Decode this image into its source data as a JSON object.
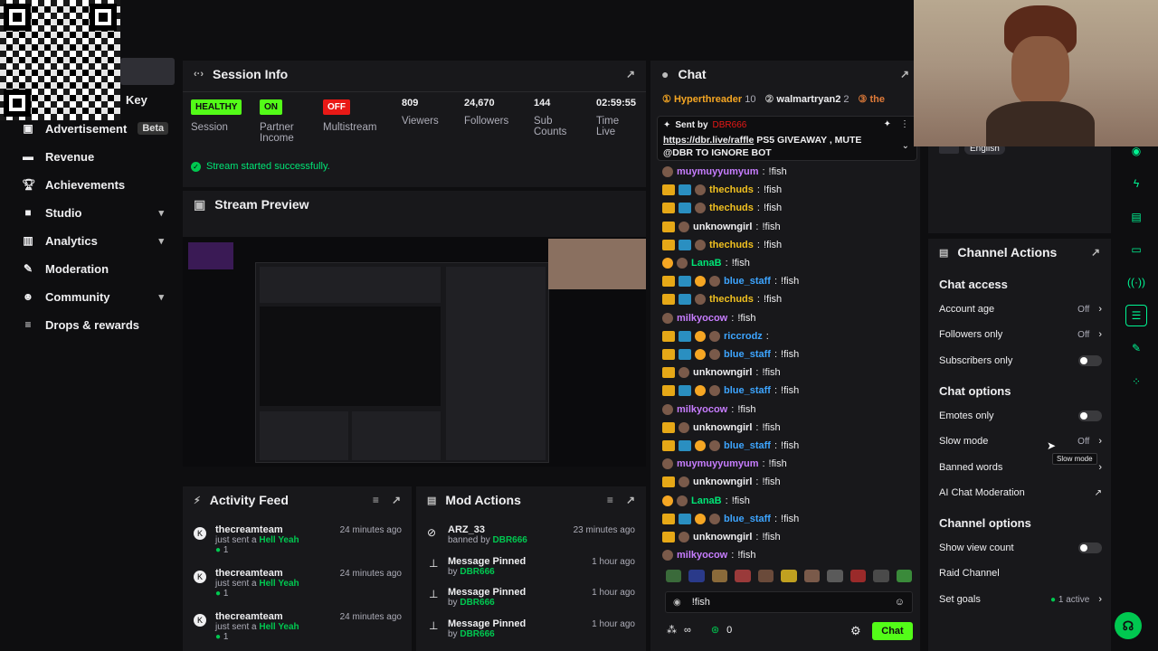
{
  "nav": {
    "key_label": "Key",
    "items": [
      {
        "label": "Advertisement",
        "badge": "Beta",
        "icon": "megaphone-icon"
      },
      {
        "label": "Revenue",
        "icon": "money-icon"
      },
      {
        "label": "Achievements",
        "icon": "trophy-icon"
      },
      {
        "label": "Studio",
        "icon": "camera-icon"
      },
      {
        "label": "Analytics",
        "icon": "chart-icon"
      },
      {
        "label": "Moderation",
        "icon": "wrench-icon"
      },
      {
        "label": "Community",
        "icon": "people-icon"
      },
      {
        "label": "Drops & rewards",
        "icon": "gift-icon"
      }
    ]
  },
  "session": {
    "title": "Session Info",
    "health_tag": "HEALTHY",
    "health_label": "Session",
    "partner_tag": "ON",
    "partner_label1": "Partner",
    "partner_label2": "Income",
    "multistream_tag": "OFF",
    "multistream_label": "Multistream",
    "viewers_value": "809",
    "viewers_label": "Viewers",
    "followers_value": "24,670",
    "followers_label": "Followers",
    "subs_value": "144",
    "subs_label1": "Sub",
    "subs_label2": "Counts",
    "time_value": "02:59:55",
    "time_label1": "Time",
    "time_label2": "Live",
    "status_msg": "Stream started successfully."
  },
  "preview": {
    "title": "Stream Preview"
  },
  "activity": {
    "title": "Activity Feed",
    "items": [
      {
        "name": "thecreamteam",
        "action": "just sent a",
        "item": "Hell Yeah",
        "count": "1",
        "time": "24 minutes ago"
      },
      {
        "name": "thecreamteam",
        "action": "just sent a",
        "item": "Hell Yeah",
        "count": "1",
        "time": "24 minutes ago"
      },
      {
        "name": "thecreamteam",
        "action": "just sent a",
        "item": "Hell Yeah",
        "count": "1",
        "time": "24 minutes ago"
      }
    ]
  },
  "mod": {
    "title": "Mod Actions",
    "items": [
      {
        "title": "ARZ_33",
        "by_prefix": "banned by",
        "by": "DBR666",
        "time": "23 minutes ago"
      },
      {
        "title": "Message Pinned",
        "by_prefix": "by",
        "by": "DBR666",
        "time": "1 hour ago"
      },
      {
        "title": "Message Pinned",
        "by_prefix": "by",
        "by": "DBR666",
        "time": "1 hour ago"
      },
      {
        "title": "Message Pinned",
        "by_prefix": "by",
        "by": "DBR666",
        "time": "1 hour ago"
      }
    ]
  },
  "chat": {
    "title": "Chat",
    "top_gifters": [
      {
        "name": "Hyperthreader",
        "count": "10"
      },
      {
        "name": "walmartryan2",
        "count": "2"
      },
      {
        "name": "the",
        "count": ""
      }
    ],
    "pinned_label": "Sent by",
    "pinned_by": "DBR666",
    "pinned_link": "https://dbr.live/raffle",
    "pinned_text1": "PS5 GIVEAWAY , MUTE",
    "pinned_text2": "@DBR TO IGNORE BOT",
    "messages": [
      {
        "user": "muymuyyumyum",
        "text": "!fish",
        "color": "#c77dff"
      },
      {
        "user": "thechuds",
        "text": "!fish",
        "color": "#f0c020"
      },
      {
        "user": "thechuds",
        "text": "!fish",
        "color": "#f0c020"
      },
      {
        "user": "unknowngirl",
        "text": "!fish",
        "color": "#efeff1"
      },
      {
        "user": "thechuds",
        "text": "!fish",
        "color": "#f0c020"
      },
      {
        "user": "LanaB",
        "text": "!fish",
        "color": "#00e676"
      },
      {
        "user": "blue_staff",
        "text": "!fish",
        "color": "#3da5ff"
      },
      {
        "user": "thechuds",
        "text": "!fish",
        "color": "#f0c020"
      },
      {
        "user": "milkyocow",
        "text": "!fish",
        "color": "#c77dff"
      },
      {
        "user": "riccrodz",
        "text": "",
        "color": "#3da5ff"
      },
      {
        "user": "blue_staff",
        "text": "!fish",
        "color": "#3da5ff"
      },
      {
        "user": "unknowngirl",
        "text": "!fish",
        "color": "#efeff1"
      },
      {
        "user": "blue_staff",
        "text": "!fish",
        "color": "#3da5ff"
      },
      {
        "user": "milkyocow",
        "text": "!fish",
        "color": "#c77dff"
      },
      {
        "user": "unknowngirl",
        "text": "!fish",
        "color": "#efeff1"
      },
      {
        "user": "blue_staff",
        "text": "!fish",
        "color": "#3da5ff"
      },
      {
        "user": "muymuyyumyum",
        "text": "!fish",
        "color": "#c77dff"
      },
      {
        "user": "unknowngirl",
        "text": "!fish",
        "color": "#efeff1"
      },
      {
        "user": "LanaB",
        "text": "!fish",
        "color": "#00e676"
      },
      {
        "user": "blue_staff",
        "text": "!fish",
        "color": "#3da5ff"
      },
      {
        "user": "unknowngirl",
        "text": "!fish",
        "color": "#efeff1"
      },
      {
        "user": "milkyocow",
        "text": "!fish",
        "color": "#c77dff"
      }
    ],
    "input_value": "!fish",
    "points_value": "0",
    "send_label": "Chat"
  },
  "language": "English",
  "channel_actions": {
    "title": "Channel Actions",
    "chat_access": "Chat access",
    "account_age": "Account age",
    "account_age_val": "Off",
    "followers_only": "Followers only",
    "followers_only_val": "Off",
    "subscribers_only": "Subscribers only",
    "chat_options": "Chat options",
    "emotes_only": "Emotes only",
    "slow_mode": "Slow mode",
    "slow_mode_val": "Off",
    "slow_mode_tooltip": "Slow mode",
    "banned_words": "Banned words",
    "ai_mod": "AI Chat Moderation",
    "channel_options": "Channel options",
    "show_view_count": "Show view count",
    "raid_channel": "Raid Channel",
    "set_goals": "Set goals",
    "set_goals_val": "1 active"
  },
  "colors": {
    "accent": "#53fc18",
    "bg": "#0e0e10",
    "panel": "#18181b"
  }
}
